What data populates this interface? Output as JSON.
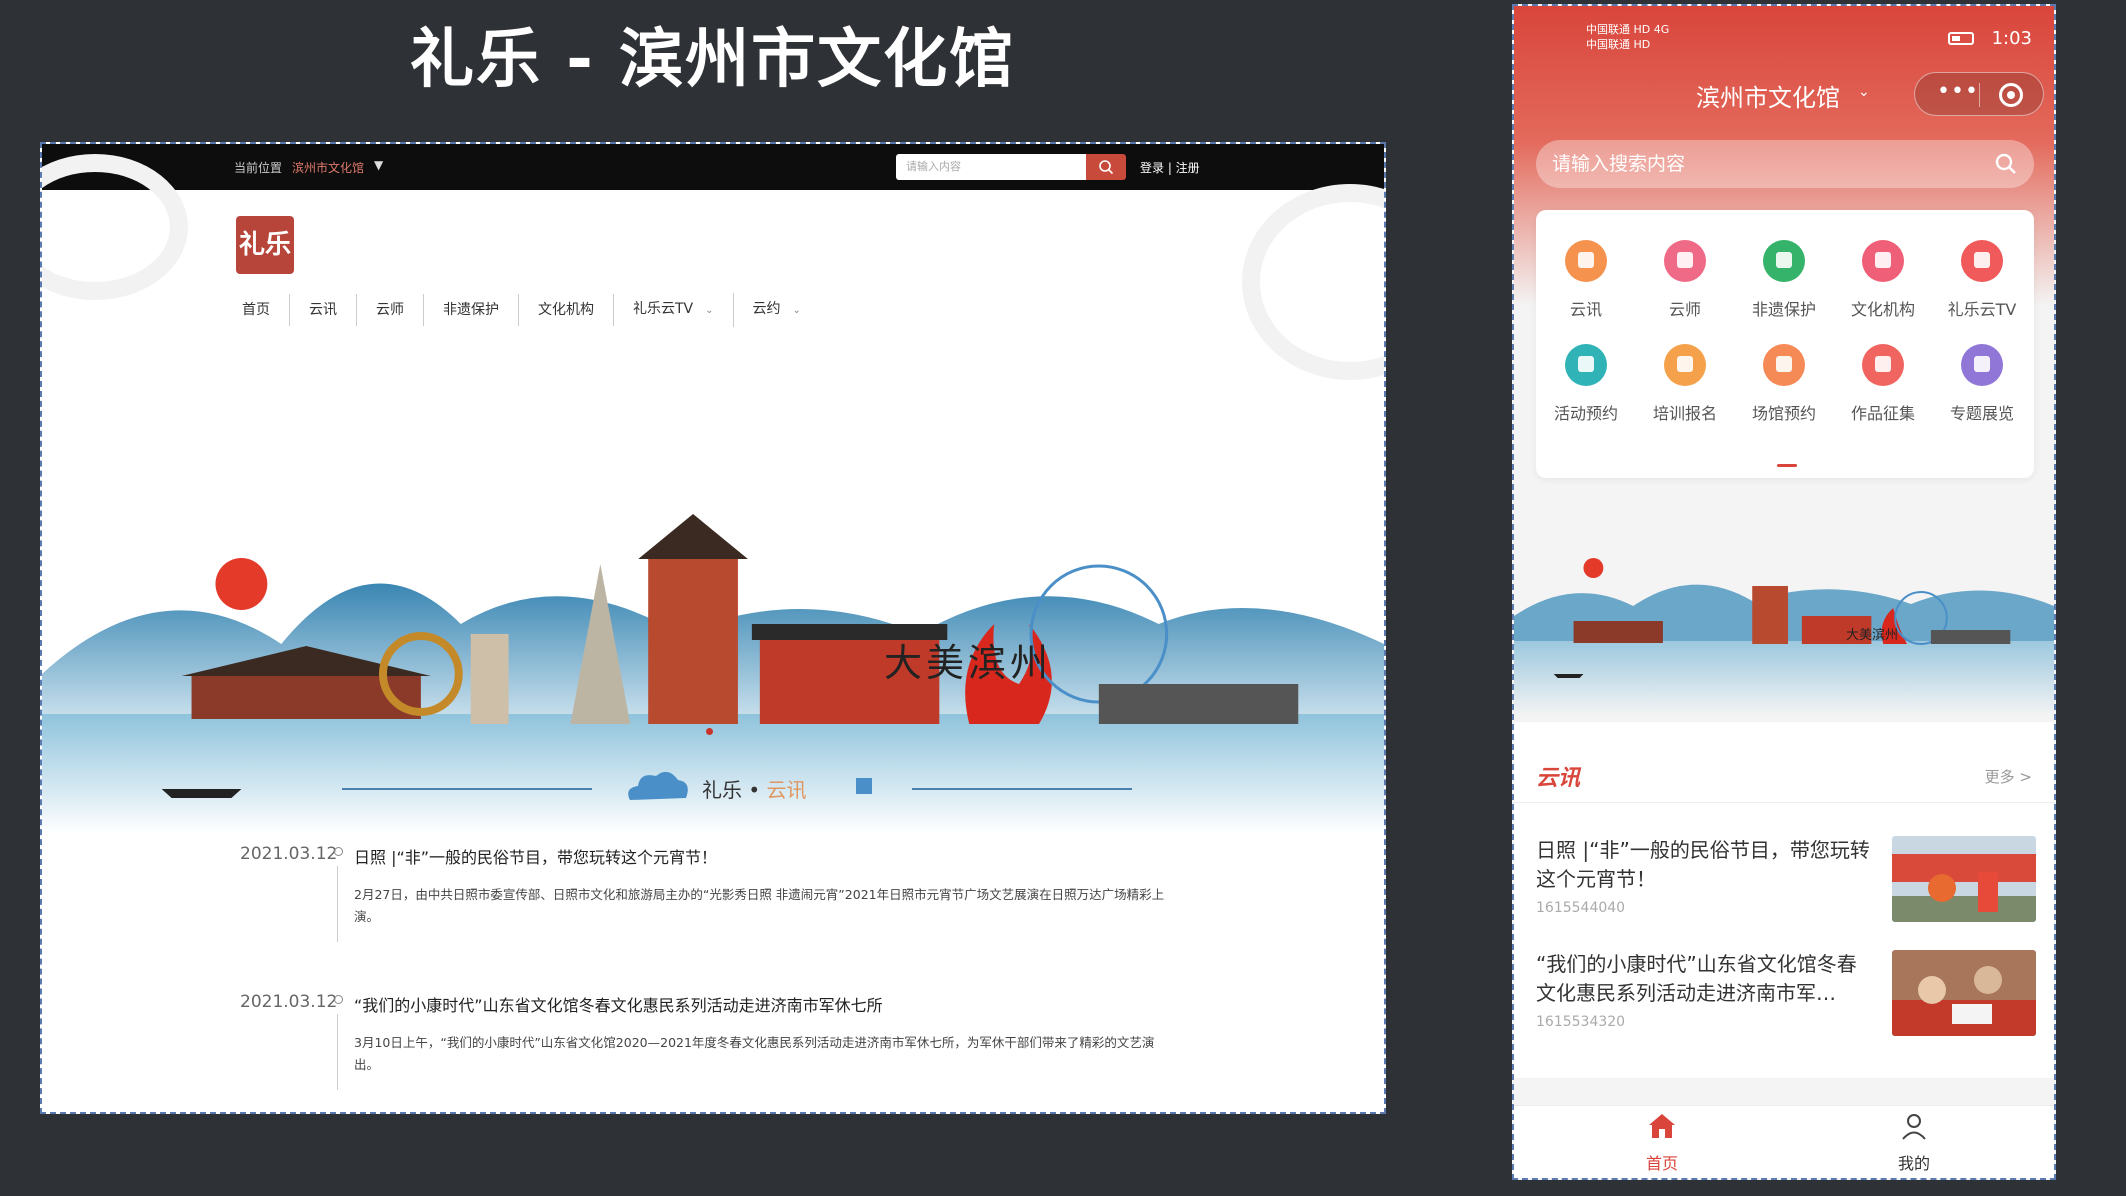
{
  "slide_title": "礼乐 - 滨州市文化馆",
  "desktop": {
    "top_bar": {
      "location_label": "当前位置",
      "location_value": "滨州市文化馆",
      "search_placeholder": "请输入内容",
      "login": "登录 | 注册"
    },
    "logo_text": "礼乐",
    "nav": [
      {
        "label": "首页",
        "has_dropdown": false
      },
      {
        "label": "云讯",
        "has_dropdown": false
      },
      {
        "label": "云师",
        "has_dropdown": false
      },
      {
        "label": "非遗保护",
        "has_dropdown": false
      },
      {
        "label": "文化机构",
        "has_dropdown": false
      },
      {
        "label": "礼乐云TV",
        "has_dropdown": true
      },
      {
        "label": "云约",
        "has_dropdown": true
      }
    ],
    "banner_slogan": "大美滨州",
    "section": {
      "prefix": "礼乐",
      "dot": "•",
      "name": "云讯"
    },
    "news": [
      {
        "date": "2021.03.12",
        "title": "日照 |“非”一般的民俗节目，带您玩转这个元宵节！",
        "desc": "2月27日，由中共日照市委宣传部、日照市文化和旅游局主办的“光影秀日照 非遗闹元宵”2021年日照市元宵节广场文艺展演在日照万达广场精彩上演。"
      },
      {
        "date": "2021.03.12",
        "title": "“我们的小康时代”山东省文化馆冬春文化惠民系列活动走进济南市军休七所",
        "desc": "3月10日上午，“我们的小康时代”山东省文化馆2020—2021年度冬春文化惠民系列活动走进济南市军休七所，为军休干部们带来了精彩的文艺演出。"
      }
    ]
  },
  "mobile": {
    "status_left_1": "中国联通 HD 4G",
    "status_left_2": "中国联通 HD",
    "status_right_time": "1:03",
    "title": "滨州市文化馆",
    "search_placeholder": "请输入搜索内容",
    "grid": [
      {
        "label": "云讯",
        "color": "#f5924e"
      },
      {
        "label": "云师",
        "color": "#ef6a86"
      },
      {
        "label": "非遗保护",
        "color": "#35b36a"
      },
      {
        "label": "文化机构",
        "color": "#ef5f78"
      },
      {
        "label": "礼乐云TV",
        "color": "#f05a5a"
      },
      {
        "label": "活动预约",
        "color": "#2fb3b6"
      },
      {
        "label": "培训报名",
        "color": "#f5a04a"
      },
      {
        "label": "场馆预约",
        "color": "#f58a56"
      },
      {
        "label": "作品征集",
        "color": "#f06560"
      },
      {
        "label": "专题展览",
        "color": "#9076d6"
      }
    ],
    "banner_text": "大美滨州",
    "news_section": {
      "title": "云讯",
      "more": "更多 >"
    },
    "news": [
      {
        "title": "日照 |“非”一般的民俗节目，带您玩转这个元宵节！",
        "time": "1615544040"
      },
      {
        "title": "“我们的小康时代”山东省文化馆冬春文化惠民系列活动走进济南市军…",
        "time": "1615534320"
      }
    ],
    "tabs": [
      {
        "label": "首页",
        "active": true
      },
      {
        "label": "我的",
        "active": false
      }
    ],
    "accent": "#d9453b"
  }
}
